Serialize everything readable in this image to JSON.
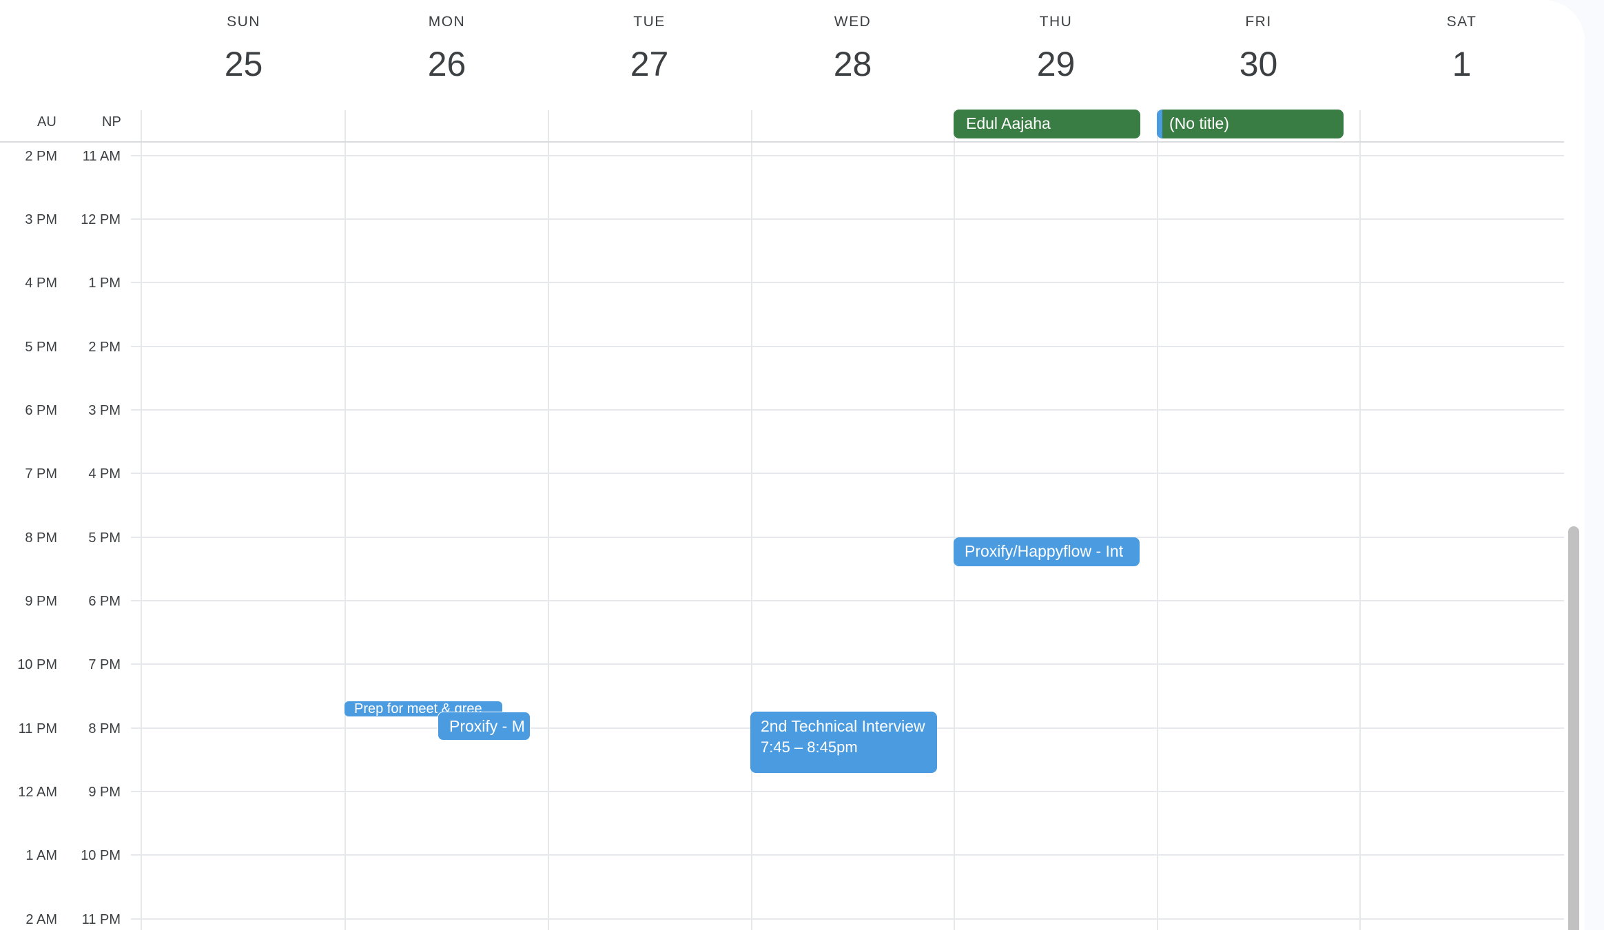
{
  "week": {
    "days": [
      {
        "name": "SUN",
        "num": "25"
      },
      {
        "name": "MON",
        "num": "26"
      },
      {
        "name": "TUE",
        "num": "27"
      },
      {
        "name": "WED",
        "num": "28"
      },
      {
        "name": "THU",
        "num": "29"
      },
      {
        "name": "FRI",
        "num": "30"
      },
      {
        "name": "SAT",
        "num": "1"
      }
    ]
  },
  "timezones": {
    "primary": "AU",
    "secondary": "NP"
  },
  "hours": [
    {
      "au": "2 PM",
      "np": "11 AM"
    },
    {
      "au": "3 PM",
      "np": "12 PM"
    },
    {
      "au": "4 PM",
      "np": "1 PM"
    },
    {
      "au": "5 PM",
      "np": "2 PM"
    },
    {
      "au": "6 PM",
      "np": "3 PM"
    },
    {
      "au": "7 PM",
      "np": "4 PM"
    },
    {
      "au": "8 PM",
      "np": "5 PM"
    },
    {
      "au": "9 PM",
      "np": "6 PM"
    },
    {
      "au": "10 PM",
      "np": "7 PM"
    },
    {
      "au": "11 PM",
      "np": "8 PM"
    },
    {
      "au": "12 AM",
      "np": "9 PM"
    },
    {
      "au": "1 AM",
      "np": "10 PM"
    },
    {
      "au": "2 AM",
      "np": "11 PM"
    }
  ],
  "events": {
    "allday_thu": "Edul Aajaha",
    "allday_fri": "(No title)",
    "thu_proxify": "Proxify/Happyflow - Int",
    "mon_prep": "Prep for meet & gree",
    "mon_proxify": "Proxify - M",
    "wed_interview_title": "2nd Technical Interview",
    "wed_interview_time": "7:45 – 8:45pm"
  },
  "colors": {
    "event_green": "#3a7d44",
    "event_blue": "#4a9be0",
    "grid": "#e6e8eb"
  }
}
